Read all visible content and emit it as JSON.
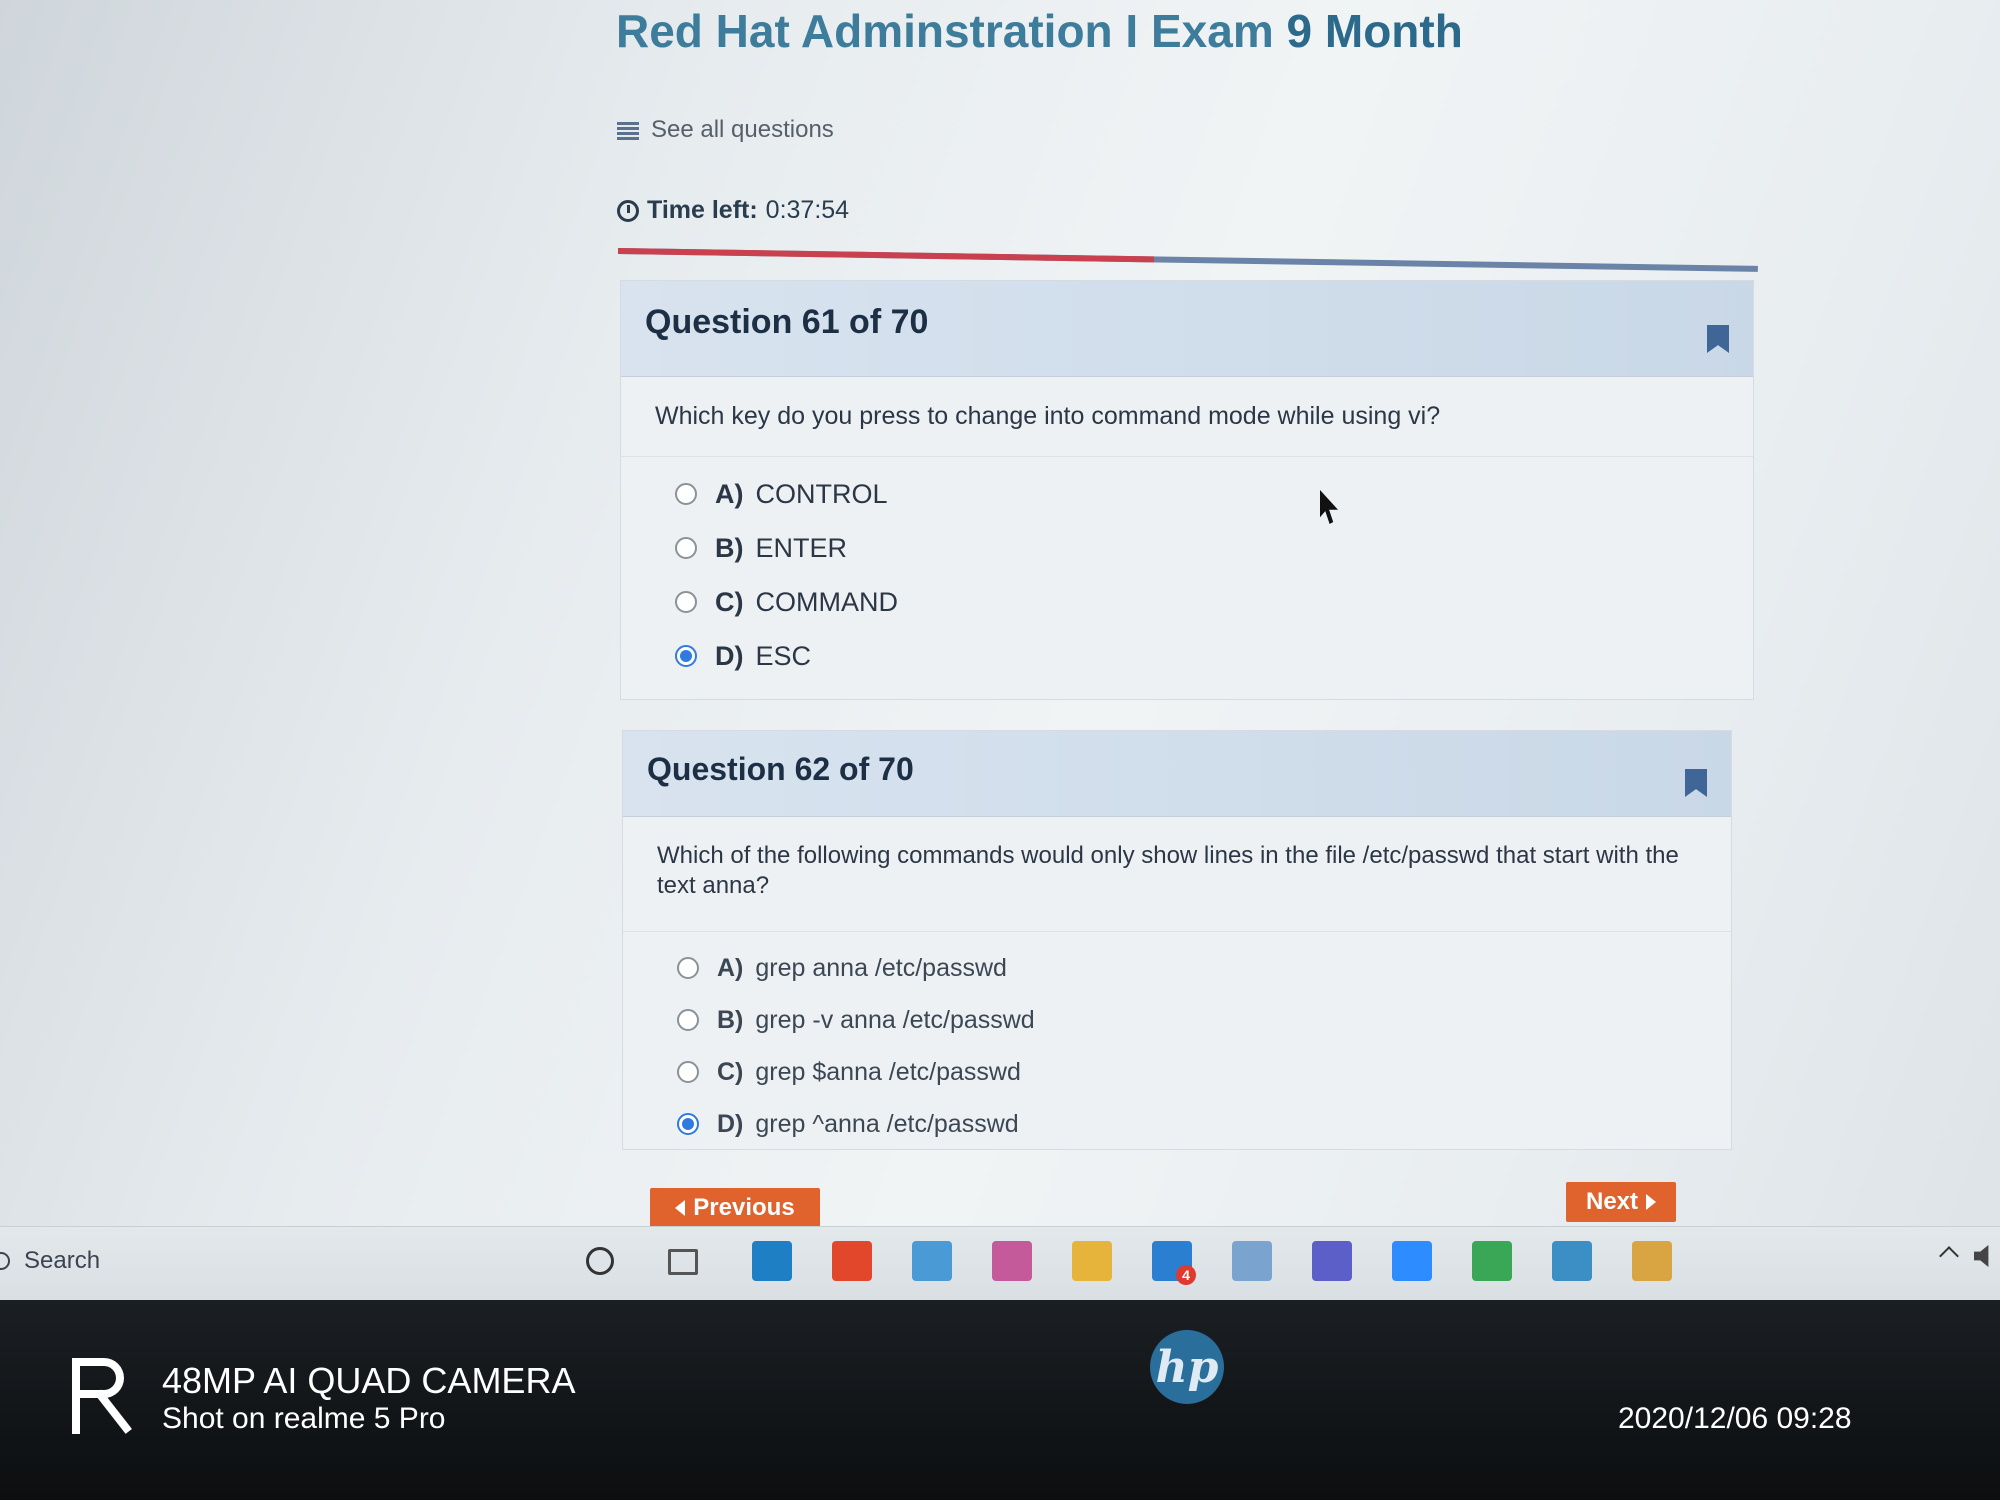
{
  "page": {
    "title_part1": "Red Hat Adminstration I Exam",
    "title_part2": "9 Month",
    "see_all_label": "See all questions",
    "time_left_label": "Time left:",
    "time_left_value": "0:37:54",
    "progress_fraction": 0.47
  },
  "questions": [
    {
      "header": "Question 61 of 70",
      "text": "Which key do you press to change into command mode while using vi?",
      "options": [
        {
          "letter": "A)",
          "label": "CONTROL",
          "selected": false
        },
        {
          "letter": "B)",
          "label": "ENTER",
          "selected": false
        },
        {
          "letter": "C)",
          "label": "COMMAND",
          "selected": false
        },
        {
          "letter": "D)",
          "label": "ESC",
          "selected": true
        }
      ]
    },
    {
      "header": "Question 62 of 70",
      "text": "Which of the following commands would only show lines in the file /etc/passwd  that start with the text anna?",
      "options": [
        {
          "letter": "A)",
          "label": "grep anna /etc/passwd",
          "selected": false
        },
        {
          "letter": "B)",
          "label": "grep -v anna /etc/passwd",
          "selected": false
        },
        {
          "letter": "C)",
          "label": "grep $anna /etc/passwd",
          "selected": false
        },
        {
          "letter": "D)",
          "label": "grep ^anna /etc/passwd",
          "selected": true
        }
      ]
    }
  ],
  "nav": {
    "previous_label": "Previous",
    "next_label": "Next"
  },
  "taskbar": {
    "search_label": "Search",
    "apps": [
      {
        "icon": "visual-studio-code-icon",
        "color": "#1f7fc4"
      },
      {
        "icon": "office-icon",
        "color": "#e2462b"
      },
      {
        "icon": "remote-desktop-icon",
        "color": "#4a9ad6"
      },
      {
        "icon": "snipping-tool-icon",
        "color": "#c45a9a"
      },
      {
        "icon": "file-explorer-icon",
        "color": "#e6b43a"
      },
      {
        "icon": "chat-app-icon",
        "color": "#2b7fd0"
      },
      {
        "icon": "notes-app-icon",
        "color": "#7aa3cf"
      },
      {
        "icon": "teams-icon",
        "color": "#5b5fc7"
      },
      {
        "icon": "zoom-icon",
        "color": "#2d8cff"
      },
      {
        "icon": "chrome-icon",
        "color": "#3aa757"
      },
      {
        "icon": "vmware-icon",
        "color": "#3c8fc4"
      },
      {
        "icon": "app-tile-icon",
        "color": "#d9a442"
      }
    ],
    "chat_badge": "4"
  },
  "bezel": {
    "brand": "hp",
    "watermark_line1": "48MP AI QUAD CAMERA",
    "watermark_line2": "Shot on realme 5 Pro",
    "watermark_date": "2020/12/06 09:28"
  }
}
